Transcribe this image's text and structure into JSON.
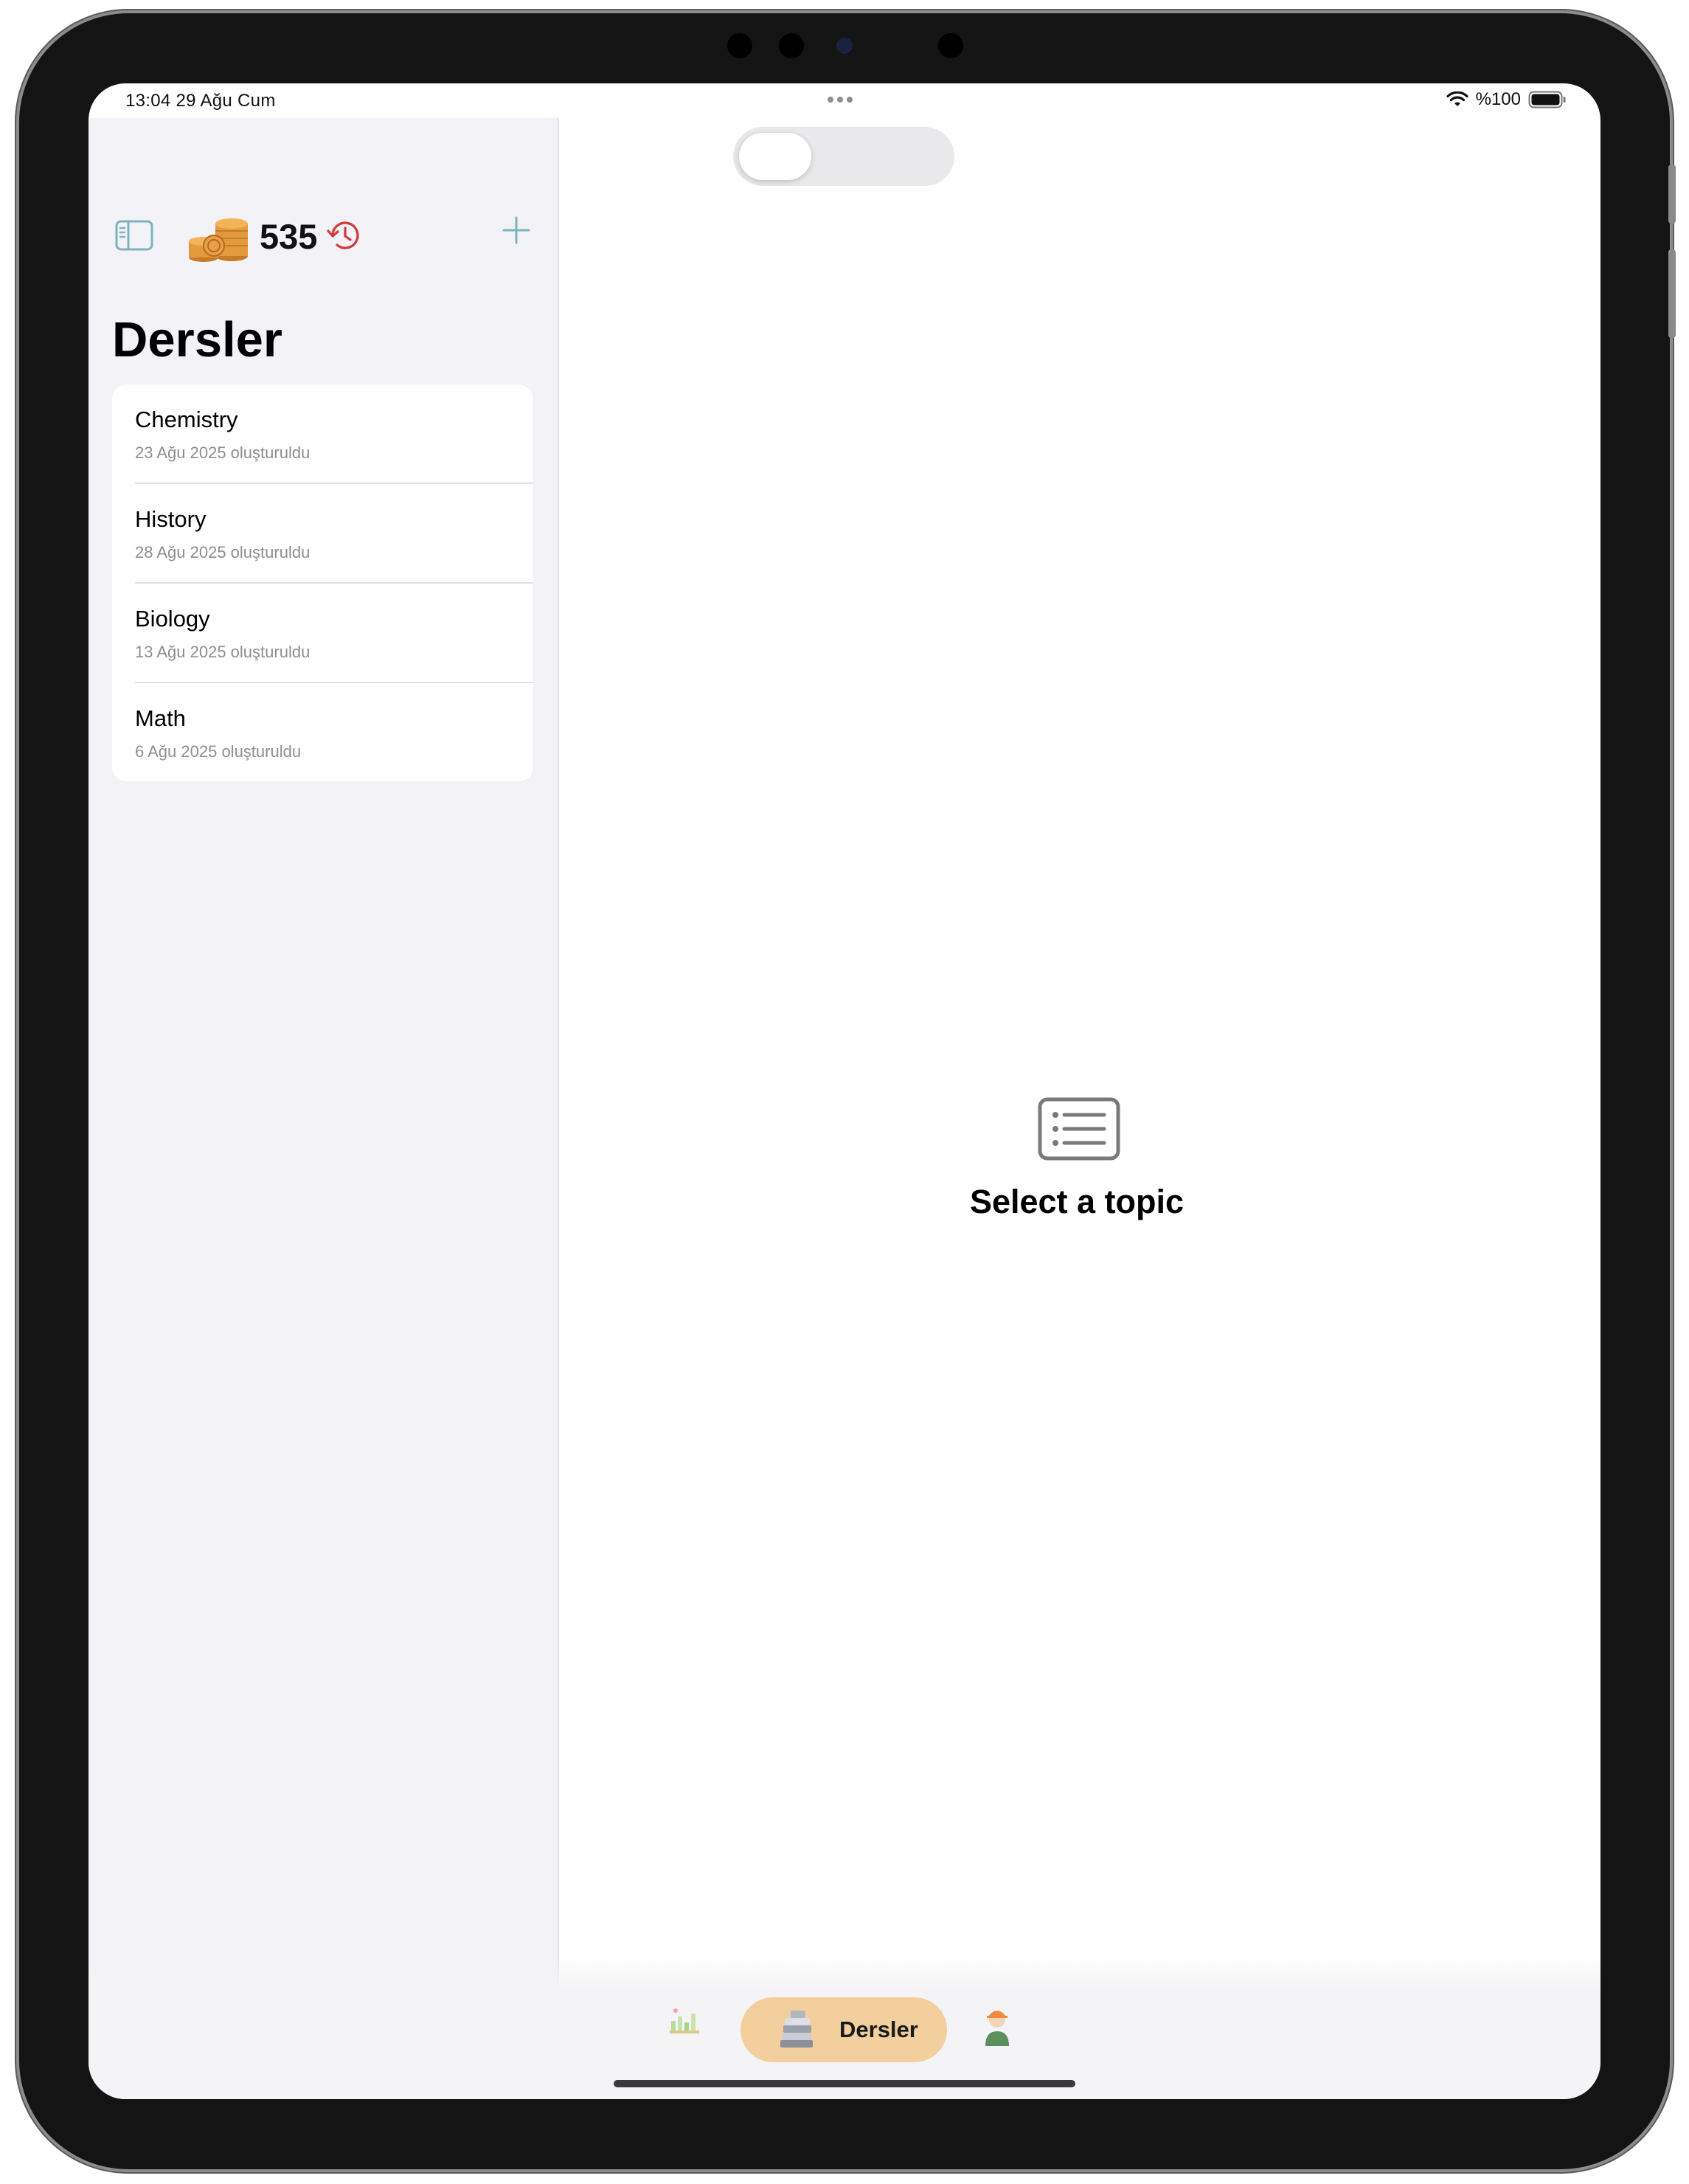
{
  "status_bar": {
    "time_date": "13:04   29 Ağu Cum",
    "battery": "%100"
  },
  "sidebar": {
    "coin_count": "535",
    "title": "Dersler",
    "courses": [
      {
        "name": "Chemistry",
        "created": "23 Ağu 2025 oluşturuldu"
      },
      {
        "name": "History",
        "created": "28 Ağu 2025 oluşturuldu"
      },
      {
        "name": "Biology",
        "created": "13 Ağu 2025 oluşturuldu"
      },
      {
        "name": "Math",
        "created": "6 Ağu 2025 oluşturuldu"
      }
    ]
  },
  "detail": {
    "empty_message": "Select a topic"
  },
  "tabbar": {
    "active_label": "Dersler"
  },
  "colors": {
    "accent_teal": "#7fb3bd",
    "history_red": "#d23a3a",
    "active_tab": "#f2cf9c",
    "sidebar_bg": "#f2f2f7"
  }
}
